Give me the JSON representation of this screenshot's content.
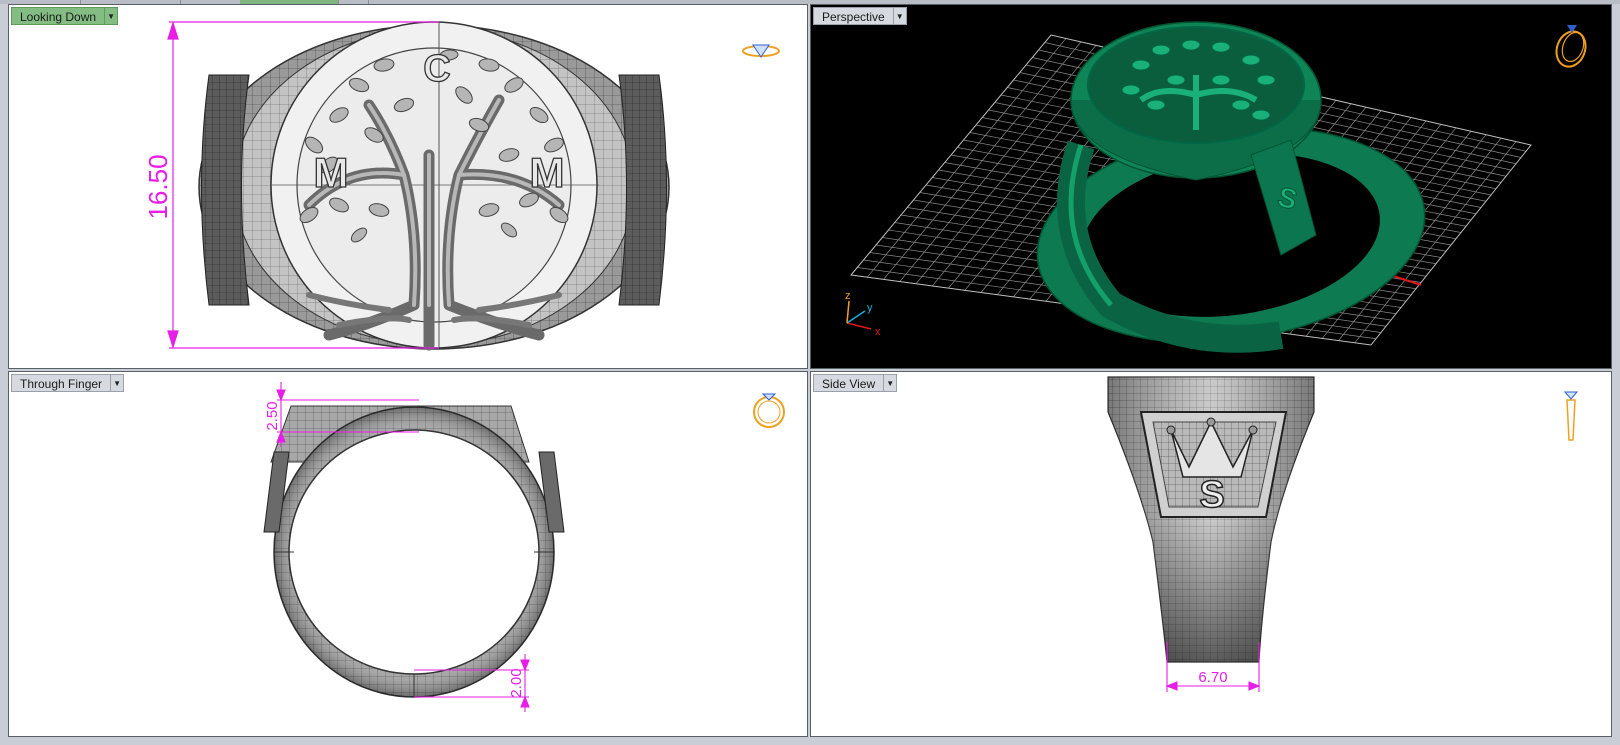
{
  "viewports": {
    "top_left": {
      "label": "Looking Down",
      "active": true
    },
    "top_right": {
      "label": "Perspective"
    },
    "bottom_left": {
      "label": "Through Finger"
    },
    "bottom_right": {
      "label": "Side View"
    }
  },
  "dimensions": {
    "height_label": "16.50",
    "top_thickness": "2.50",
    "bottom_thickness": "2.00",
    "shank_width": "6.70"
  },
  "engraving": {
    "top_letter": "C",
    "left_letter": "M",
    "right_letter": "M",
    "side_letter": "S"
  },
  "axes": {
    "x": "x",
    "y": "y",
    "z": "z"
  },
  "colors": {
    "dimension": "#e61ee6",
    "ring_green": "#0f8a5c",
    "active_tab": "#83bd83",
    "gizmo_orange": "#f0a020",
    "gizmo_blue": "#3060d0"
  },
  "icons": [
    "view-gizmo-ring-icon",
    "dropdown-arrow-icon",
    "axis-gizmo-icon"
  ]
}
